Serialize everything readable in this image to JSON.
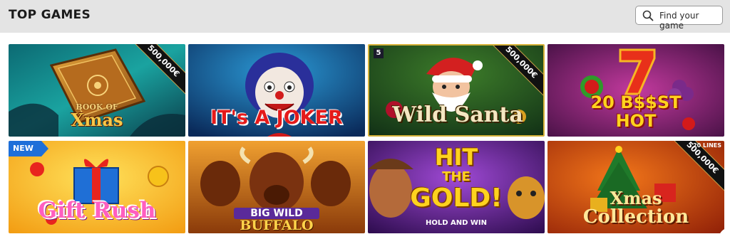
{
  "header": {
    "title": "TOP GAMES",
    "search_label": "Find your game"
  },
  "games": [
    {
      "title": "Book of Xmas",
      "title_line1": "BOOK OF",
      "title_line2": "Xmas",
      "ribbon": "500,000€"
    },
    {
      "title": "IT's A JOKER",
      "title_line1": "IT's A JOKER"
    },
    {
      "title": "Wild Santa",
      "title_line1": "Wild Santa",
      "ribbon": "500,000€",
      "provider": "5"
    },
    {
      "title": "20 Boost Hot",
      "title_line1": "20 B$$ST",
      "title_line2": "HOT"
    },
    {
      "title": "Gift Rush",
      "title_line1": "Gift Rush",
      "badge": "NEW"
    },
    {
      "title": "Big Wild Buffalo",
      "title_line1": "BIG WILD",
      "title_line2": "BUFFALO"
    },
    {
      "title": "Hit the Gold!",
      "title_line1": "HIT",
      "title_line2": "THE",
      "title_line3": "GOLD!",
      "subtitle": "HOLD AND WIN"
    },
    {
      "title": "Xmas Collection",
      "title_line1": "Xmas",
      "title_line2": "Collection",
      "ribbon": "500,000€",
      "lines": "20 LINES"
    }
  ],
  "colors": {
    "header_bg": "#e4e4e4",
    "page_bg": "#ffffff",
    "new_badge": "#1e6fd9",
    "ribbon": "#111111"
  }
}
